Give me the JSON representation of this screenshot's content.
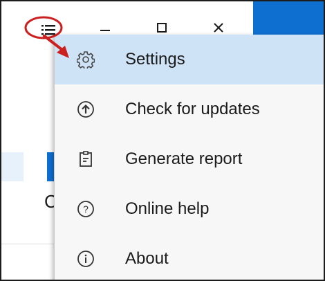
{
  "window": {
    "menu_icon": "hamburger-icon",
    "minimize_icon": "minimize-icon",
    "maximize_icon": "maximize-icon",
    "close_icon": "close-icon"
  },
  "background": {
    "partial_letter": "C"
  },
  "menu": {
    "items": [
      {
        "label": "Settings",
        "icon": "gear-icon",
        "selected": true
      },
      {
        "label": "Check for updates",
        "icon": "upload-arrow-icon",
        "selected": false
      },
      {
        "label": "Generate report",
        "icon": "clipboard-report-icon",
        "selected": false
      },
      {
        "label": "Online help",
        "icon": "question-circle-icon",
        "selected": false
      },
      {
        "label": "About",
        "icon": "info-circle-icon",
        "selected": false
      }
    ]
  },
  "colors": {
    "accent": "#0f6fd1",
    "selected_bg": "#cfe3f7",
    "annotation": "#cc1f1f"
  }
}
